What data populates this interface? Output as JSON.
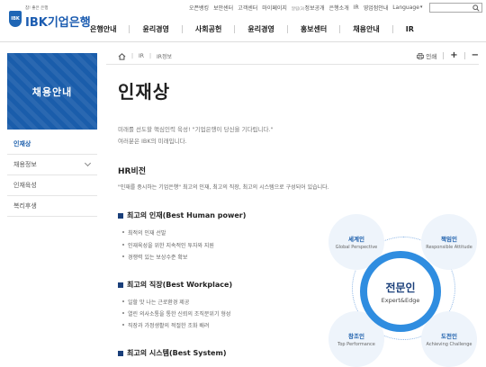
{
  "header": {
    "util_links": [
      "오픈뱅킹",
      "보안센터",
      "고객센터",
      "마이페이지",
      "정보공개",
      "은행소개",
      "IR",
      "영업점안내"
    ],
    "util_prefix": "알림(3)",
    "language_label": "Language",
    "search_placeholder": "",
    "logo": {
      "slogan": "참! 좋은 은행",
      "brand": "IBK기업은행",
      "mark": "IBK"
    },
    "gnb": [
      "은행안내",
      "윤리경영",
      "사회공헌",
      "윤리경영",
      "홍보센터",
      "채용안내",
      "IR"
    ]
  },
  "lnb": {
    "banner": "채용안내",
    "items": [
      {
        "label": "인재상",
        "active": true
      },
      {
        "label": "채용정보",
        "has_sub": true
      },
      {
        "label": "인재육성"
      },
      {
        "label": "복리후생"
      }
    ]
  },
  "breadcrumb": [
    "IR",
    "IR정보"
  ],
  "tools": {
    "print": "인쇄",
    "plus": "+",
    "minus": "−"
  },
  "main": {
    "title": "인재상",
    "intro1": "미래를 선도할 핵심인력 육성! \"기업은행이 당신을 기다립니다.\"",
    "intro2": "여러분은 IBK의 미래입니다.",
    "hr_heading": "HR비전",
    "hr_desc": "\"인재를 중시하는 기업은행\" 최고의 인재, 최고의 직장, 최고의 시스템으로 구성되어 있습니다.",
    "sections": [
      {
        "title": "최고의 인재(Best Human power)",
        "bullets": [
          "최적의 인재 선발",
          "인재육성을 위한 지속적인 투자와 지원",
          "경쟁력 있는 보상수준 확보"
        ]
      },
      {
        "title": "최고의 직장(Best Workplace)",
        "bullets": [
          "일할 맛 나는 근로환경 제공",
          "열린 의사소통을 통한 신뢰의 조직분위기 형성",
          "직장과 가정생활의 적절한 조화 배려"
        ]
      },
      {
        "title": "최고의 시스템(Best System)",
        "bullets": []
      }
    ]
  },
  "diagram": {
    "center": {
      "ko": "전문인",
      "en": "Expert&Edge"
    },
    "satellites": [
      {
        "ko": "세계인",
        "en": "Global Perspective"
      },
      {
        "ko": "책임인",
        "en": "Responsible Attitude"
      },
      {
        "ko": "창조인",
        "en": "Top Performance"
      },
      {
        "ko": "도전인",
        "en": "Achieving Challenge"
      }
    ]
  },
  "colors": {
    "brand": "#1a5dab",
    "accent": "#2f8de0",
    "dark": "#1a3f7a"
  }
}
